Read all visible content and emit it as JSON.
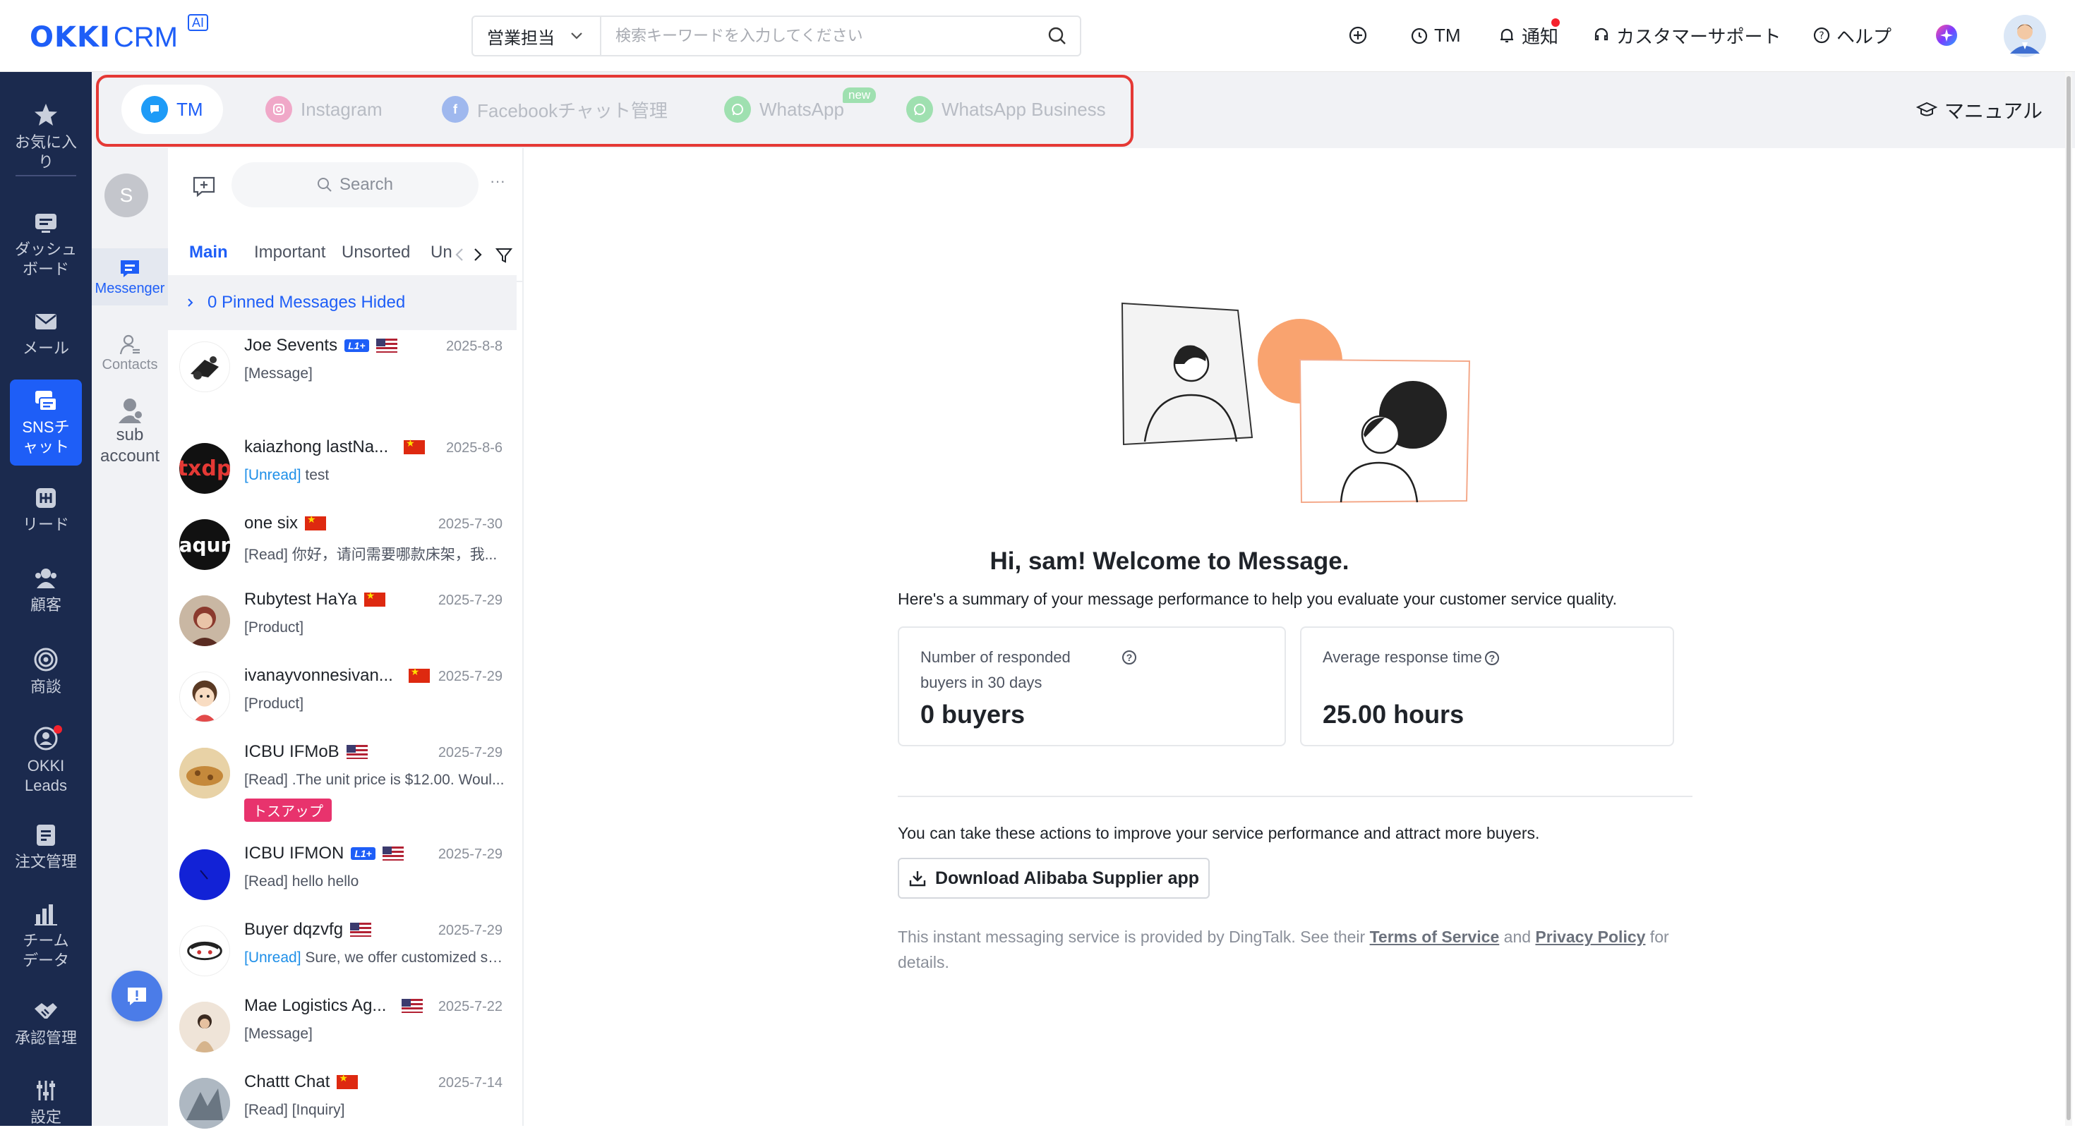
{
  "app": {
    "logo": "OKKI",
    "logo_crm": "CRM",
    "logo_ai": "AI"
  },
  "search": {
    "scope": "営業担当",
    "placeholder": "検索キーワードを入力してください"
  },
  "topbar": {
    "tm": "TM",
    "notify": "通知",
    "support": "カスタマーサポート",
    "help": "ヘルプ"
  },
  "leftnav": [
    {
      "label": "お気に入り",
      "icon": "star-icon"
    },
    {
      "label": "ダッシュボード",
      "icon": "dashboard-icon"
    },
    {
      "label": "メール",
      "icon": "mail-icon"
    },
    {
      "label": "SNSチャット",
      "icon": "chat-icon",
      "active": true
    },
    {
      "label": "リード",
      "icon": "lead-icon"
    },
    {
      "label": "顧客",
      "icon": "customer-icon"
    },
    {
      "label": "商談",
      "icon": "target-icon"
    },
    {
      "label": "OKKI Leads",
      "icon": "okki-leads-icon"
    },
    {
      "label": "注文管理",
      "icon": "order-icon"
    },
    {
      "label": "チームデータ",
      "icon": "bar-chart-icon"
    },
    {
      "label": "承認管理",
      "icon": "handshake-icon"
    },
    {
      "label": "設定",
      "icon": "settings-icon"
    }
  ],
  "channels": [
    {
      "label": "TM",
      "active": true
    },
    {
      "label": "Instagram"
    },
    {
      "label": "Facebookチャット管理"
    },
    {
      "label": "WhatsApp",
      "badge": "new"
    },
    {
      "label": "WhatsApp Business"
    }
  ],
  "manual": "マニュアル",
  "subnav": {
    "avatar": "S",
    "messenger": "Messenger",
    "contacts": "Contacts",
    "sub_account": "sub account"
  },
  "convlist": {
    "search": "Search",
    "tabs": [
      "Main",
      "Important",
      "Unsorted",
      "Un"
    ],
    "pinned": "0 Pinned Messages Hided",
    "items": [
      {
        "name": "Joe Sevents",
        "date": "2025-8-8",
        "status": "",
        "msg": "[Message]",
        "l1": "L1+",
        "flag": "us"
      },
      {
        "name": "kaiazhong lastNa...",
        "date": "2025-8-6",
        "status": "[Unread]",
        "msg": " test",
        "flag": "cn",
        "avatar_text": "txdp"
      },
      {
        "name": "one six",
        "date": "2025-7-30",
        "status": "",
        "msg": "[Read] 你好，请问需要哪款床架，我...",
        "flag": "cn",
        "avatar_text": "aqur"
      },
      {
        "name": "Rubytest HaYa",
        "date": "2025-7-29",
        "status": "",
        "msg": "[Product]",
        "flag": "cn"
      },
      {
        "name": "ivanayvonnesivan...",
        "date": "2025-7-29",
        "status": "",
        "msg": "[Product]",
        "flag": "cn"
      },
      {
        "name": "ICBU IFMoB",
        "date": "2025-7-29",
        "status": "",
        "msg": "[Read] .The unit price is $12.00. Woul...",
        "flag": "us",
        "tag": "トスアップ"
      },
      {
        "name": "ICBU IFMON",
        "date": "2025-7-29",
        "status": "",
        "msg": "[Read] hello hello",
        "l1": "L1+",
        "flag": "us"
      },
      {
        "name": "Buyer dqzvfg",
        "date": "2025-7-29",
        "status": "[Unread]",
        "msg": " Sure, we offer customized so...",
        "flag": "us"
      },
      {
        "name": "Mae Logistics Ag...",
        "date": "2025-7-22",
        "status": "",
        "msg": "[Message]",
        "flag": "us"
      },
      {
        "name": "Chattt Chat",
        "date": "2025-7-14",
        "status": "",
        "msg": "[Read] [Inquiry]",
        "flag": "cn"
      }
    ]
  },
  "main": {
    "welcome": "Hi, sam! Welcome to Message.",
    "summary": "Here's a summary of your message performance to help you evaluate your customer service quality.",
    "card1_title": "Number of responded buyers in 30 days",
    "card1_value": "0 buyers",
    "card2_title": "Average response time",
    "card2_value": "25.00 hours",
    "actions": "You can take these actions to improve your service performance and attract more buyers.",
    "download": "Download Alibaba Supplier app",
    "disc_a": "This instant messaging service is provided by DingTalk. See their ",
    "disc_tos": "Terms of Service",
    "disc_and": " and ",
    "disc_pp": "Privacy Policy",
    "disc_b": " for details."
  },
  "colors": {
    "primary": "#1e5ef7",
    "nav_bg": "#1b2a4e",
    "highlight_border": "#e53935",
    "tag_pink": "#e8336d"
  }
}
